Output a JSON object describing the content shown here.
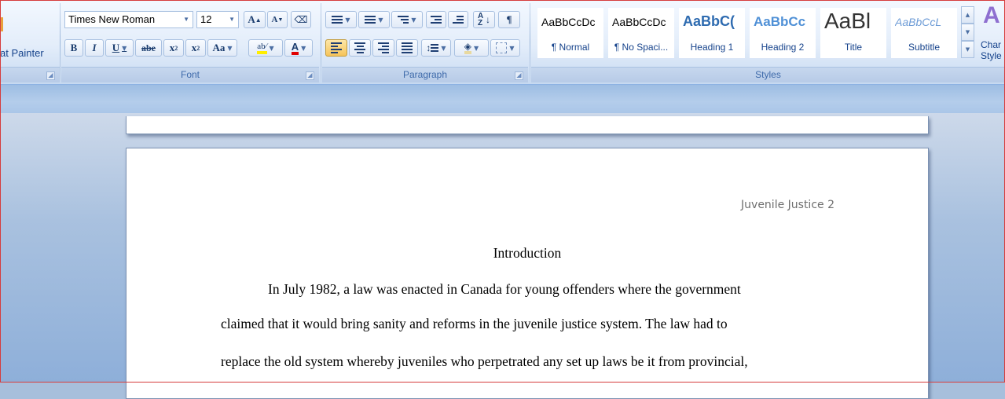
{
  "clipboard": {
    "format_painter_label": "at Painter"
  },
  "font": {
    "group_label": "Font",
    "family": "Times New Roman",
    "size": "12",
    "grow": "A",
    "shrink": "A",
    "bold": "B",
    "italic": "I",
    "underline": "U",
    "strike": "abe",
    "subscript": "x",
    "superscript": "x",
    "change_case": "Aa",
    "highlight": "ab",
    "font_color": "A"
  },
  "paragraph": {
    "group_label": "Paragraph",
    "sort": "AZ",
    "show_marks": "¶"
  },
  "styles": {
    "group_label": "Styles",
    "items": [
      {
        "sample": "AaBbCcDc",
        "name": "¶ Normal"
      },
      {
        "sample": "AaBbCcDc",
        "name": "¶ No Spaci..."
      },
      {
        "sample": "AaBbC(",
        "name": "Heading 1"
      },
      {
        "sample": "AaBbCc",
        "name": "Heading 2"
      },
      {
        "sample": "AaBl",
        "name": "Title"
      },
      {
        "sample": "AaBbCcL",
        "name": "Subtitle"
      }
    ],
    "change_styles_label": "Char\nStyle"
  },
  "document": {
    "running_head": "Juvenile Justice 2",
    "title": "Introduction",
    "lines": [
      "In July 1982, a law was enacted in Canada for young offenders where the government",
      "claimed that it would bring sanity and reforms in the juvenile justice system. The law had to",
      "replace the old system whereby juveniles  who perpetrated any set up laws be it from provincial,"
    ]
  },
  "colors": {
    "ribbon_text": "#15428b",
    "highlight": "#ffee00",
    "font_color": "#e00000",
    "active": "#f6c45a"
  }
}
